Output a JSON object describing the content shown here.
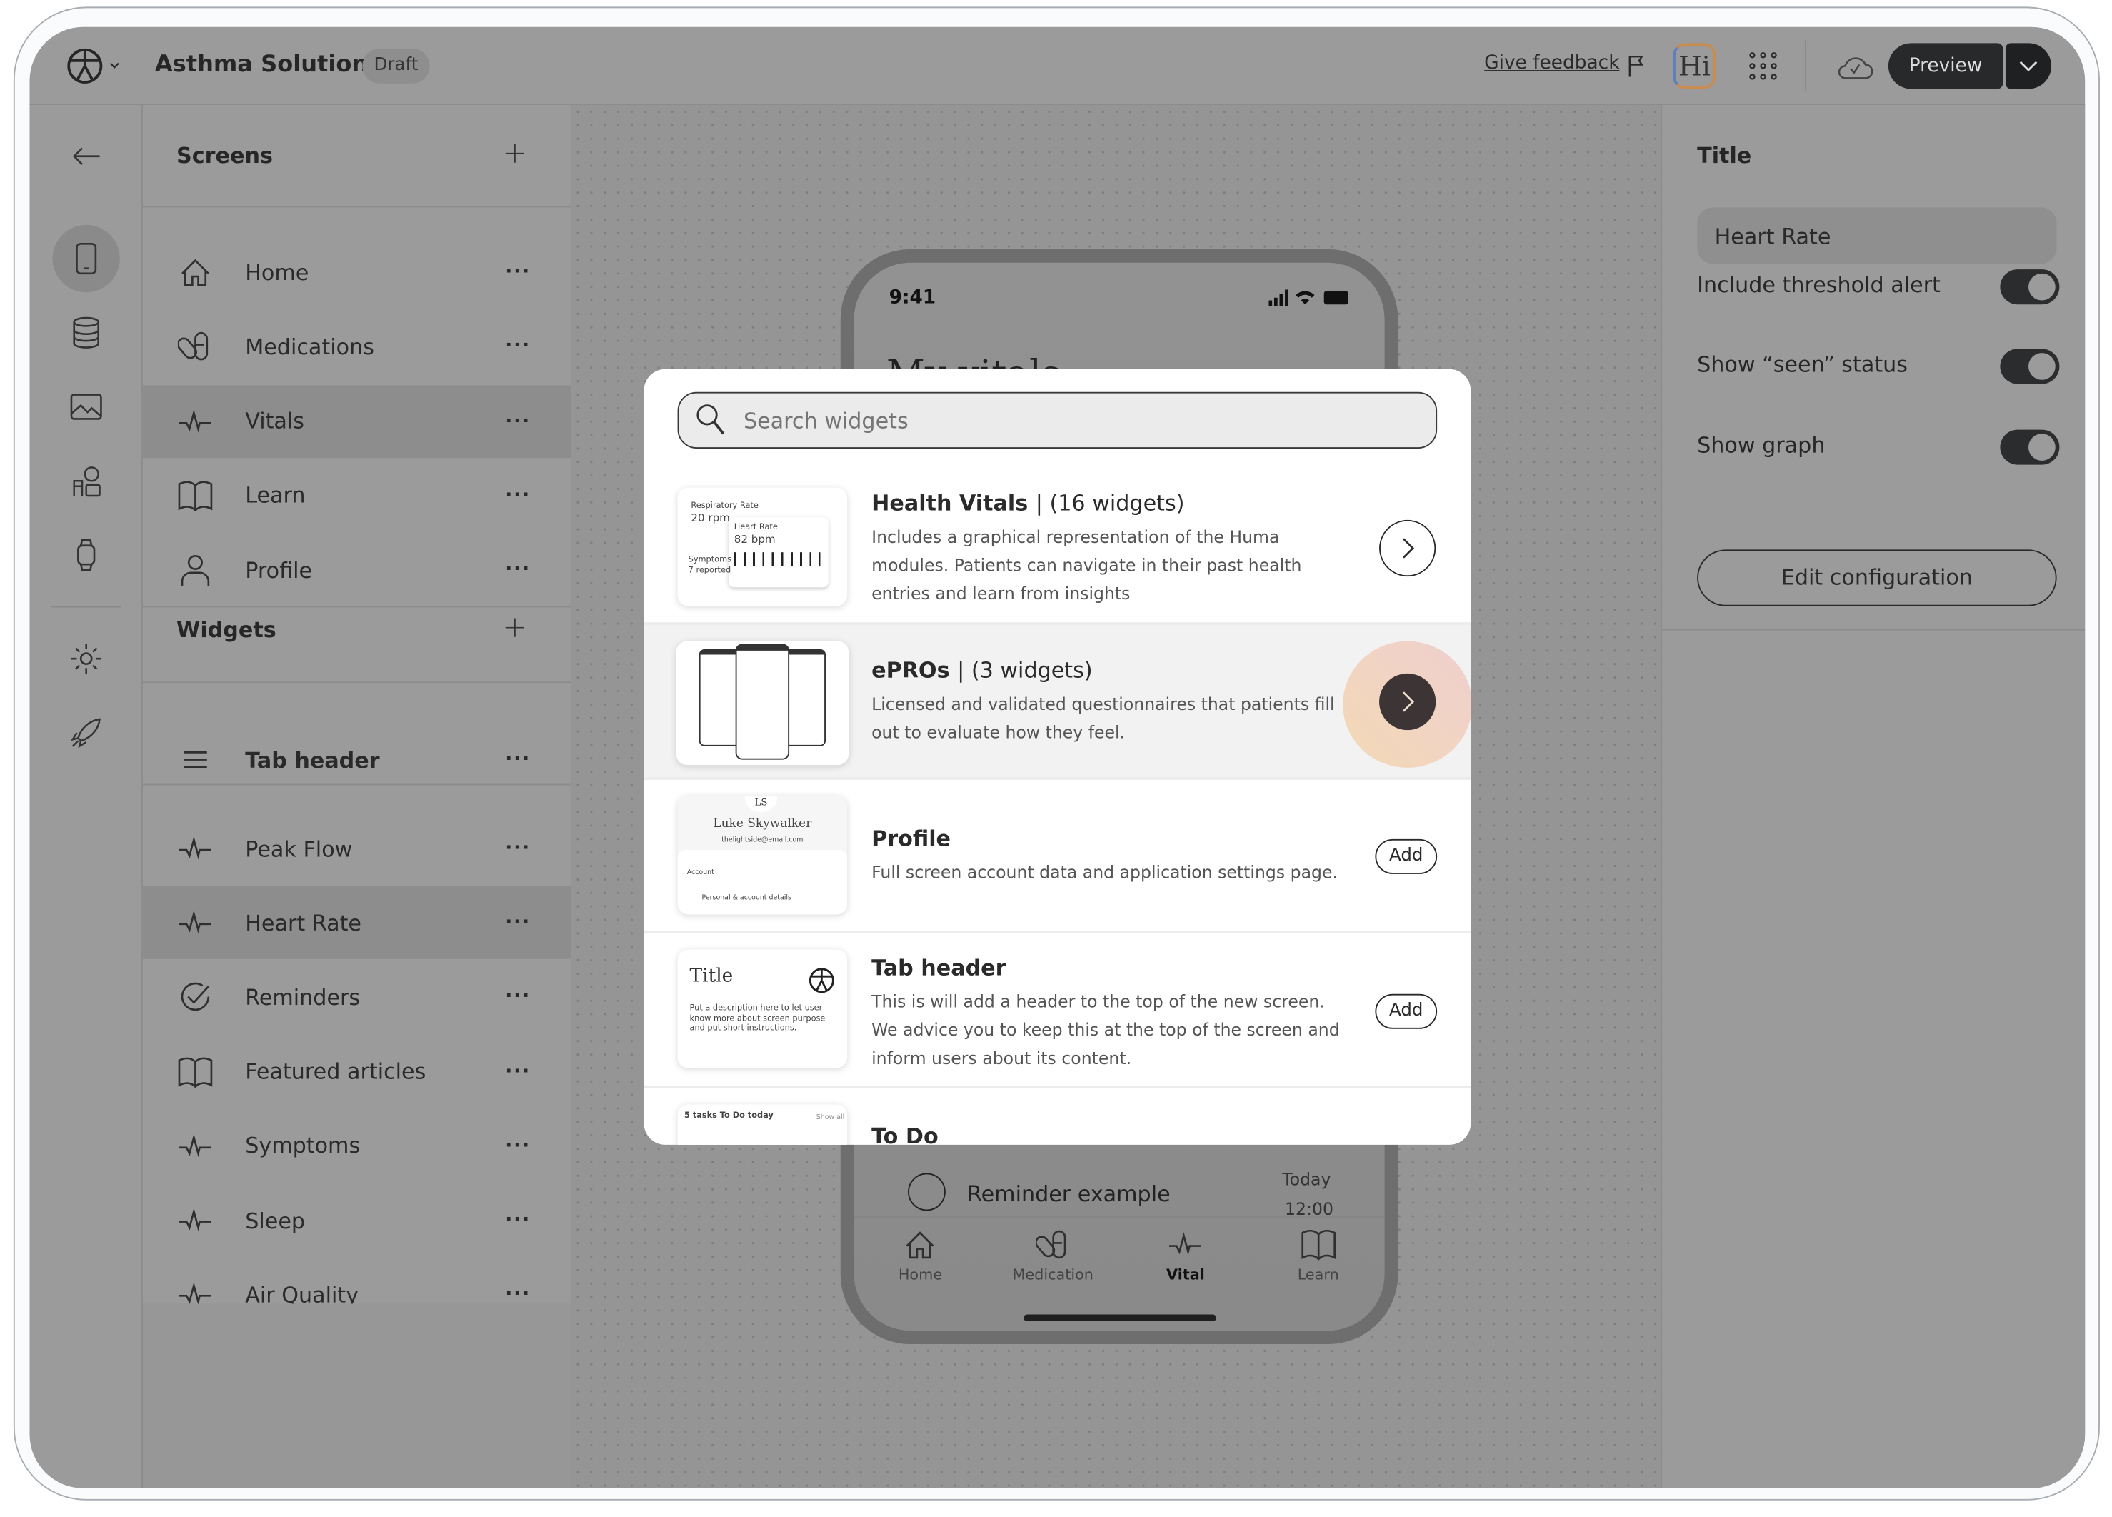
{
  "app": {
    "title": "Asthma Solution",
    "status": "Draft",
    "feedback": "Give feedback",
    "assistant": "Hi",
    "preview": "Preview"
  },
  "screens": {
    "header": "Screens",
    "items": [
      {
        "label": "Home",
        "icon": "home-icon"
      },
      {
        "label": "Medications",
        "icon": "pills-icon"
      },
      {
        "label": "Vitals",
        "icon": "pulse-icon",
        "selected": true
      },
      {
        "label": "Learn",
        "icon": "book-icon"
      },
      {
        "label": "Profile",
        "icon": "user-icon"
      }
    ]
  },
  "widgets": {
    "header": "Widgets",
    "items": [
      {
        "label": "Tab header",
        "icon": "menu-icon"
      },
      {
        "label": "Peak Flow",
        "icon": "pulse-icon"
      },
      {
        "label": "Heart Rate",
        "icon": "pulse-icon",
        "selected": true
      },
      {
        "label": "Reminders",
        "icon": "check-circle-icon"
      },
      {
        "label": "Featured articles",
        "icon": "book-icon"
      },
      {
        "label": "Symptoms",
        "icon": "pulse-icon"
      },
      {
        "label": "Sleep",
        "icon": "pulse-icon"
      },
      {
        "label": "Air Quality",
        "icon": "pulse-icon"
      }
    ]
  },
  "phone": {
    "time": "9:41",
    "heading": "My vitals",
    "reminder": "Reminder example",
    "reminder_day": "Today",
    "reminder_time": "12:00",
    "tabs": [
      {
        "label": "Home"
      },
      {
        "label": "Medication"
      },
      {
        "label": "Vital",
        "active": true
      },
      {
        "label": "Learn"
      }
    ]
  },
  "settings": {
    "title_label": "Title",
    "title_value": "Heart Rate",
    "toggles": [
      {
        "label": "Include threshold alert",
        "on": true
      },
      {
        "label": "Show “seen” status",
        "on": true
      },
      {
        "label": "Show graph",
        "on": true
      }
    ],
    "edit_button": "Edit configuration"
  },
  "modal": {
    "search_placeholder": "Search widgets",
    "rows": [
      {
        "title": "Health Vitals",
        "count": "| (16 widgets)",
        "desc": "Includes a graphical representation of the Huma modules. Patients can navigate in their past health entries and learn from insights",
        "action": "arrow",
        "thumb": {
          "a": "Respiratory Rate",
          "b": "20 rpm",
          "c": "Heart Rate",
          "d": "82 bpm",
          "e": "Symptoms",
          "f": "7 reported"
        }
      },
      {
        "title": "ePROs",
        "count": "| (3 widgets)",
        "desc": "Licensed and validated questionnaires that patients fill out to evaluate how they feel.",
        "action": "arrow",
        "hovered": true
      },
      {
        "title": "Profile",
        "count": "",
        "desc": "Full screen account data and application settings page.",
        "action": "Add",
        "thumb": {
          "initials": "LS",
          "name": "Luke Skywalker",
          "email": "thelightside@email.com",
          "section": "Account",
          "item": "Personal & account details"
        }
      },
      {
        "title": "Tab header",
        "count": "",
        "desc": "This is will add a header to the top of the new screen. We advice you to keep this at the top of the screen and inform users about its content.",
        "action": "Add",
        "thumb": {
          "title": "Title",
          "desc": "Put a description here to let user know more about screen purpose and put short instructions."
        }
      },
      {
        "title": "To Do",
        "count": "",
        "desc": "",
        "thumb": {
          "title": "5 tasks To Do today",
          "link": "Show all"
        }
      }
    ]
  },
  "colors": {
    "dark": "#28292b",
    "dim_bg": "#9b9b9b",
    "hover_gradient": [
      "#f3d9b5",
      "#efcfcf"
    ]
  }
}
